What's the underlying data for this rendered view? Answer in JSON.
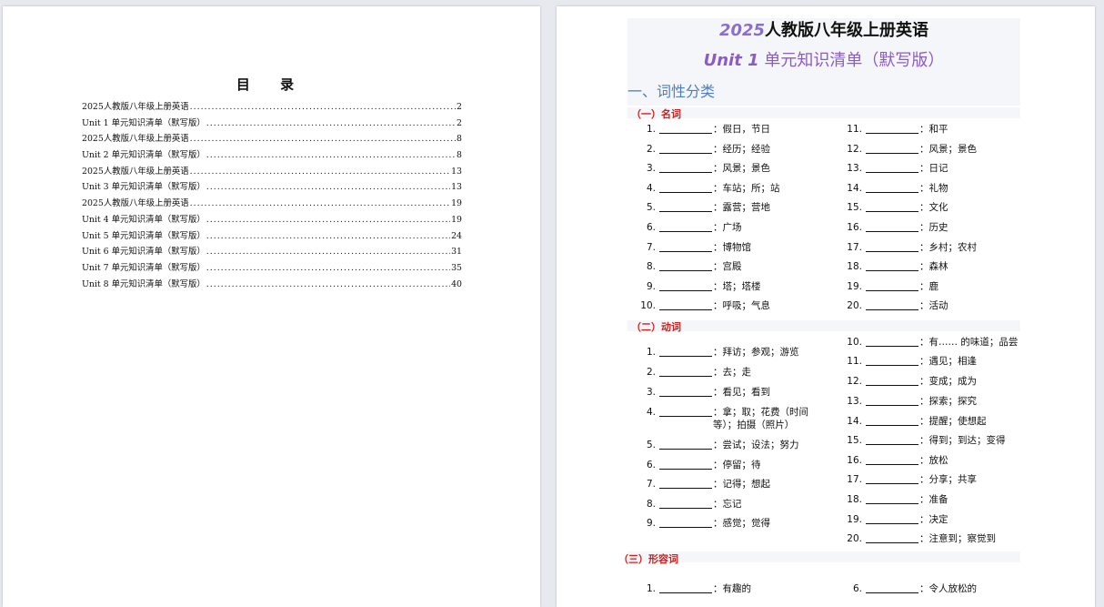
{
  "toc": {
    "title": "目  录",
    "entries": [
      {
        "text": "2025人教版八年级上册英语",
        "page": "2"
      },
      {
        "text": "Unit 1 单元知识清单（默写版）",
        "page": "2"
      },
      {
        "text": "2025人教版八年级上册英语",
        "page": "8"
      },
      {
        "text": "Unit 2 单元知识清单（默写版）",
        "page": "8"
      },
      {
        "text": "2025人教版八年级上册英语",
        "page": "13"
      },
      {
        "text": "Unit 3 单元知识清单（默写版）",
        "page": "13"
      },
      {
        "text": "2025人教版八年级上册英语",
        "page": "19"
      },
      {
        "text": "Unit 4 单元知识清单（默写版）",
        "page": "19"
      },
      {
        "text": "Unit 5 单元知识清单（默写版）",
        "page": "24"
      },
      {
        "text": "Unit 6 单元知识清单（默写版）",
        "page": "31"
      },
      {
        "text": "Unit 7 单元知识清单（默写版）",
        "page": "35"
      },
      {
        "text": "Unit 8 单元知识清单（默写版）",
        "page": "40"
      }
    ]
  },
  "doc": {
    "title_year": "2025",
    "title_rest": "人教版八年级上册英语",
    "unit_label": "Unit 1",
    "unit_rest": "单元知识清单（默写版）",
    "section": "一、词性分类",
    "nouns_heading": "（一）名词",
    "verbs_heading": "（二）动词",
    "adj_heading": "（三）形容词",
    "nouns_left": [
      {
        "n": "1.",
        "m": "：假日，节日"
      },
      {
        "n": "2.",
        "m": "：经历；经验"
      },
      {
        "n": "3.",
        "m": "：风景；景色"
      },
      {
        "n": "4.",
        "m": "：车站；所；站"
      },
      {
        "n": "5.",
        "m": "：露营；营地"
      },
      {
        "n": "6.",
        "m": "：广场"
      },
      {
        "n": "7.",
        "m": "：博物馆"
      },
      {
        "n": "8.",
        "m": "：宫殿"
      },
      {
        "n": "9.",
        "m": "：塔；塔楼"
      },
      {
        "n": "10.",
        "m": "：呼吸；气息"
      }
    ],
    "nouns_right": [
      {
        "n": "11.",
        "m": "：和平"
      },
      {
        "n": "12.",
        "m": "：风景；景色"
      },
      {
        "n": "13.",
        "m": "：日记"
      },
      {
        "n": "14.",
        "m": "：礼物"
      },
      {
        "n": "15.",
        "m": "：文化"
      },
      {
        "n": "16.",
        "m": "：历史"
      },
      {
        "n": "17.",
        "m": "：乡村；农村"
      },
      {
        "n": "18.",
        "m": "：森林"
      },
      {
        "n": "19.",
        "m": "：鹿"
      },
      {
        "n": "20.",
        "m": "：活动"
      }
    ],
    "verbs_left": [
      {
        "n": "1.",
        "m": "：拜访；参观；游览"
      },
      {
        "n": "2.",
        "m": "：去；走"
      },
      {
        "n": "3.",
        "m": "：看见；看到"
      },
      {
        "n": "4.",
        "m": "：拿；取；花费（时间等）；拍摄（照片）"
      },
      {
        "n": "5.",
        "m": "：尝试；设法；努力"
      },
      {
        "n": "6.",
        "m": "：停留；待"
      },
      {
        "n": "7.",
        "m": "：记得；想起"
      },
      {
        "n": "8.",
        "m": "：忘记"
      },
      {
        "n": "9.",
        "m": "：感觉；觉得"
      }
    ],
    "verbs_right": [
      {
        "n": "10.",
        "m": "：有…… 的味道；品尝"
      },
      {
        "n": "11.",
        "m": "：遇见；相逢"
      },
      {
        "n": "12.",
        "m": "：变成；成为"
      },
      {
        "n": "13.",
        "m": "：探索；探究"
      },
      {
        "n": "14.",
        "m": "：提醒；使想起"
      },
      {
        "n": "15.",
        "m": "：得到；到达；变得"
      },
      {
        "n": "16.",
        "m": "：放松"
      },
      {
        "n": "17.",
        "m": "：分享；共享"
      },
      {
        "n": "18.",
        "m": "：准备"
      },
      {
        "n": "19.",
        "m": "：决定"
      },
      {
        "n": "20.",
        "m": "：注意到；察觉到"
      }
    ],
    "adj_left": [
      {
        "n": "1.",
        "m": "：有趣的"
      }
    ],
    "adj_right": [
      {
        "n": "6.",
        "m": "：令人放松的"
      }
    ]
  }
}
